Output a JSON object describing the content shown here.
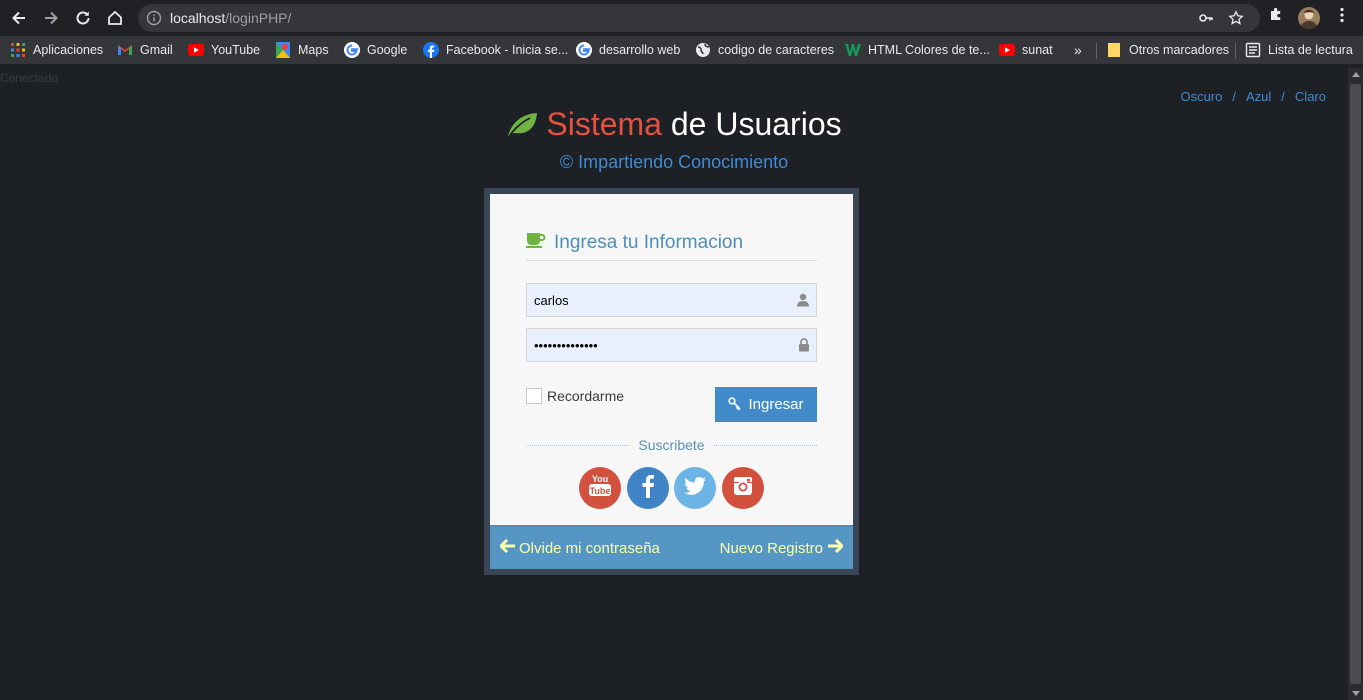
{
  "browser": {
    "url_host": "localhost",
    "url_path": "/loginPHP/",
    "bookmarks": [
      {
        "label": "Aplicaciones",
        "icon": "apps-grid-icon"
      },
      {
        "label": "Gmail",
        "icon": "gmail-icon"
      },
      {
        "label": "YouTube",
        "icon": "youtube-icon"
      },
      {
        "label": "Maps",
        "icon": "maps-icon"
      },
      {
        "label": "Google",
        "icon": "google-icon"
      },
      {
        "label": "Facebook - Inicia se...",
        "icon": "facebook-icon"
      },
      {
        "label": "desarrollo web",
        "icon": "google-icon"
      },
      {
        "label": "codigo de caracteres",
        "icon": "globe-icon"
      },
      {
        "label": "HTML Colores de te...",
        "icon": "w-icon"
      },
      {
        "label": "sunat",
        "icon": "youtube-icon"
      }
    ],
    "overflow_label": "»",
    "other_bookmarks": "Otros marcadores",
    "reading_list": "Lista de lectura"
  },
  "page": {
    "status": "Conectado",
    "themes": [
      "Oscuro",
      "Azul",
      "Claro"
    ],
    "theme_separator": "/",
    "title_part1": "Sistema",
    "title_part2": "de Usuarios",
    "subtitle": "© Impartiendo Conocimiento",
    "colors": {
      "background": "#1d2024",
      "accent_red": "#e2523f",
      "accent_blue": "#3e8bd3",
      "leaf_green": "#6fb443",
      "button_blue": "#428bca",
      "footer_blue": "#5596c4",
      "footer_link": "#fefeaa"
    }
  },
  "login": {
    "form_title": "Ingresa tu Informacion",
    "username_value": "carlos",
    "password_value": "••••••••••••••",
    "remember_label": "Recordarme",
    "submit_label": "Ingresar",
    "subscribe_label": "Suscribete",
    "social": [
      "youtube",
      "facebook",
      "twitter",
      "instagram"
    ],
    "forgot_password": "Olvide mi contraseña",
    "register": "Nuevo Registro"
  }
}
